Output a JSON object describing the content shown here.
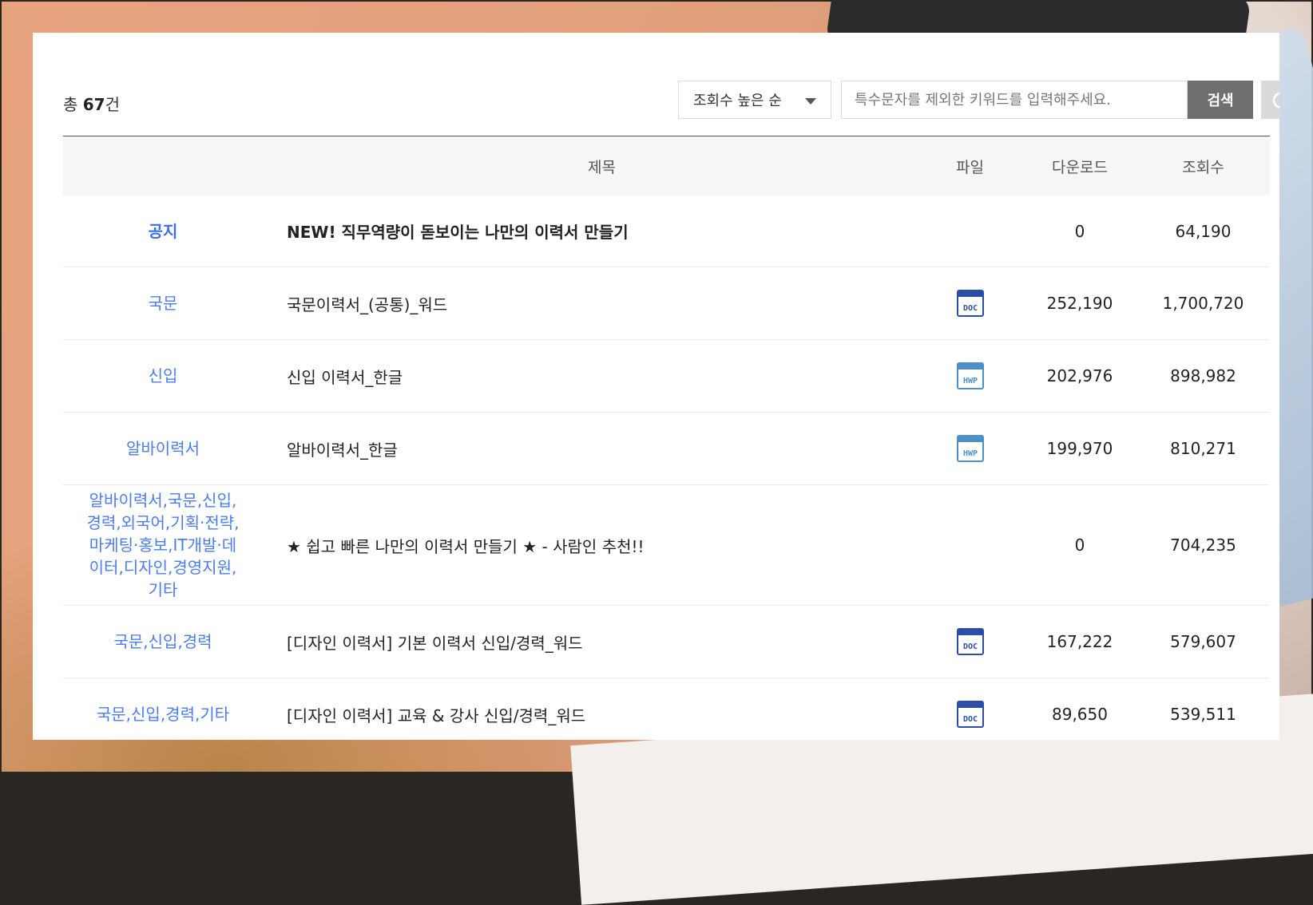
{
  "toolbar": {
    "total_prefix": "총 ",
    "total_count": "67",
    "total_suffix": "건",
    "sort_selected": "조회수 높은 순",
    "search_placeholder": "특수문자를 제외한 키워드를 입력해주세요.",
    "search_label": "검색"
  },
  "table": {
    "headers": {
      "title": "제목",
      "file": "파일",
      "downloads": "다운로드",
      "views": "조회수"
    },
    "rows": [
      {
        "category": "공지",
        "title": "NEW! 직무역량이 돋보이는 나만의 이력서 만들기",
        "file": "",
        "downloads": "0",
        "views": "64,190"
      },
      {
        "category": "국문",
        "title": "국문이력서_(공통)_워드",
        "file": "DOC",
        "downloads": "252,190",
        "views": "1,700,720"
      },
      {
        "category": "신입",
        "title": "신입 이력서_한글",
        "file": "HWP",
        "downloads": "202,976",
        "views": "898,982"
      },
      {
        "category": "알바이력서",
        "title": "알바이력서_한글",
        "file": "HWP",
        "downloads": "199,970",
        "views": "810,271"
      },
      {
        "category": "알바이력서,국문,신입,경력,외국어,기획·전략,마케팅·홍보,IT개발·데이터,디자인,경영지원,기타",
        "title": "★ 쉽고 빠른 나만의 이력서 만들기 ★ - 사람인 추천!!",
        "file": "",
        "downloads": "0",
        "views": "704,235"
      },
      {
        "category": "국문,신입,경력",
        "title": "[디자인 이력서] 기본 이력서 신입/경력_워드",
        "file": "DOC",
        "downloads": "167,222",
        "views": "579,607"
      },
      {
        "category": "국문,신입,경력,기타",
        "title": "[디자인 이력서] 교육 & 강사 신입/경력_워드",
        "file": "DOC",
        "downloads": "89,650",
        "views": "539,511"
      }
    ]
  },
  "colors": {
    "accent": "#4a7cf0",
    "doc_icon": "#2b4fa8",
    "hwp_icon": "#4f8fc8"
  }
}
